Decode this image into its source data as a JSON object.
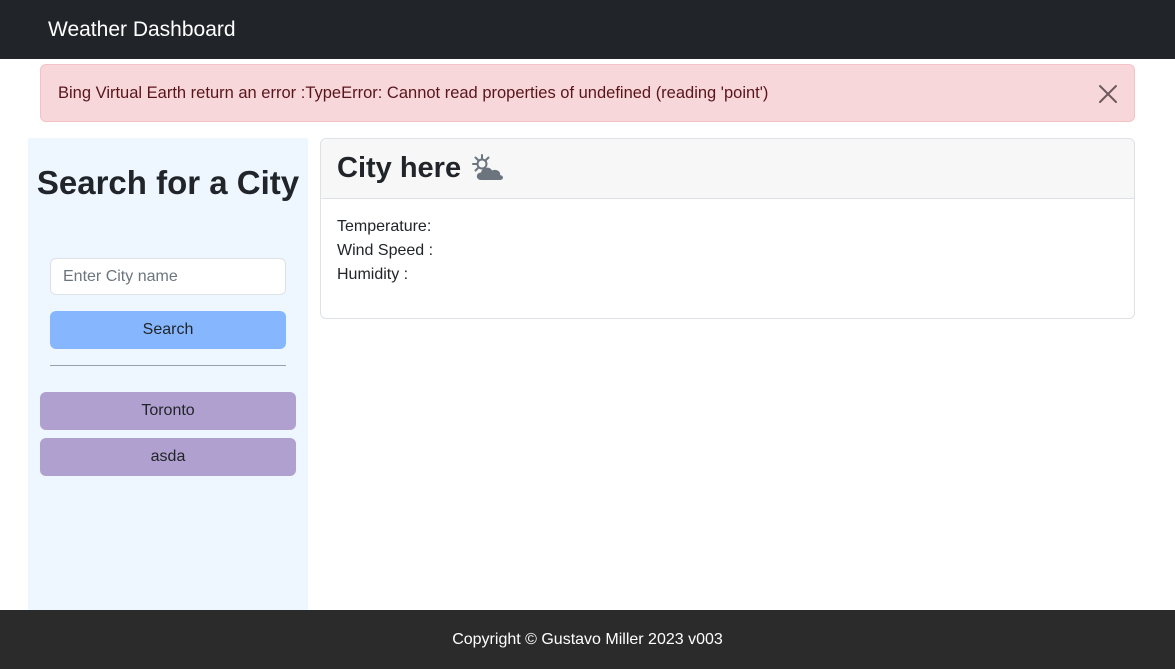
{
  "navbar": {
    "brand": "Weather Dashboard"
  },
  "alert": {
    "message": "Bing Virtual Earth return an error :TypeError: Cannot read properties of undefined (reading 'point')",
    "close_icon": "close-icon"
  },
  "sidebar": {
    "title": "Search for a City",
    "search_placeholder": "Enter City name",
    "search_value": "",
    "search_label": "Search",
    "history": [
      "Toronto",
      "asda"
    ]
  },
  "weather": {
    "city": "City here",
    "icon": "partly-cloudy-icon",
    "temperature_label": "Temperature:",
    "wind_label": "Wind Speed :",
    "humidity_label": "Humidity :"
  },
  "footer": {
    "text": "Copyright © Gustavo Miller 2023 v003"
  },
  "colors": {
    "navbar": "#212529",
    "alert_bg": "#f8d7da",
    "sidebar_bg": "#eef6ff",
    "search_button": "#86b7fe",
    "history_button": "#b0a0cf",
    "footer": "#2b2b2b"
  }
}
